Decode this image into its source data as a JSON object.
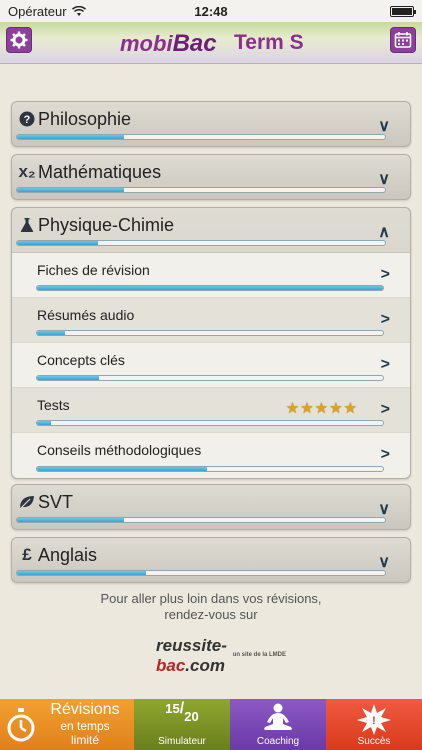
{
  "status_bar": {
    "carrier": "Opérateur",
    "time": "12:48"
  },
  "header": {
    "logo_prefix": "mobi",
    "logo_suffix": "Bac",
    "term": "Term S"
  },
  "subjects": [
    {
      "title": "Philosophie",
      "icon": "question-circle-icon",
      "progress": 0.29,
      "expanded": false
    },
    {
      "title": "Mathématiques",
      "icon": "x-squared-icon",
      "icon_text": "x₂",
      "progress": 0.29,
      "expanded": false
    },
    {
      "title": "Physique-Chimie",
      "icon": "flask-icon",
      "progress": 0.22,
      "expanded": true,
      "items": [
        {
          "label": "Fiches de révision",
          "progress": 1.0
        },
        {
          "label": "Résumés audio",
          "progress": 0.08
        },
        {
          "label": "Concepts clés",
          "progress": 0.18
        },
        {
          "label": "Tests",
          "progress": 0.04,
          "stars": 5
        },
        {
          "label": "Conseils méthodologiques",
          "progress": 0.49
        }
      ]
    },
    {
      "title": "SVT",
      "icon": "leaf-icon",
      "progress": 0.29,
      "expanded": false
    },
    {
      "title": "Anglais",
      "icon": "pound-icon",
      "icon_text": "£",
      "progress": 0.35,
      "expanded": false
    }
  ],
  "promo": {
    "line1": "Pour aller plus loin dans vos révisions,",
    "line2": "rendez-vous sur",
    "logo_left": "reussite-",
    "logo_right": "bac",
    "logo_tld": ".com",
    "logo_tagline": "un site de la LMDE"
  },
  "tabs": [
    {
      "title": "Révisions",
      "subtitle_1": "en temps",
      "subtitle_2": "limité",
      "icon": "stopwatch-icon"
    },
    {
      "label": "Simulateur",
      "score_top": "15",
      "score_bottom": "20",
      "icon": "score-icon"
    },
    {
      "label": "Coaching",
      "icon": "meditation-icon"
    },
    {
      "label": "Succès",
      "icon": "success-burst-icon"
    }
  ],
  "colors": {
    "accent_purple": "#8e3f9d",
    "progress_blue": "#3aa3cf",
    "tab_orange": "#e0801c",
    "tab_olive": "#6a7f1e",
    "tab_violet": "#6a3aa8",
    "tab_red": "#d93a1c"
  }
}
